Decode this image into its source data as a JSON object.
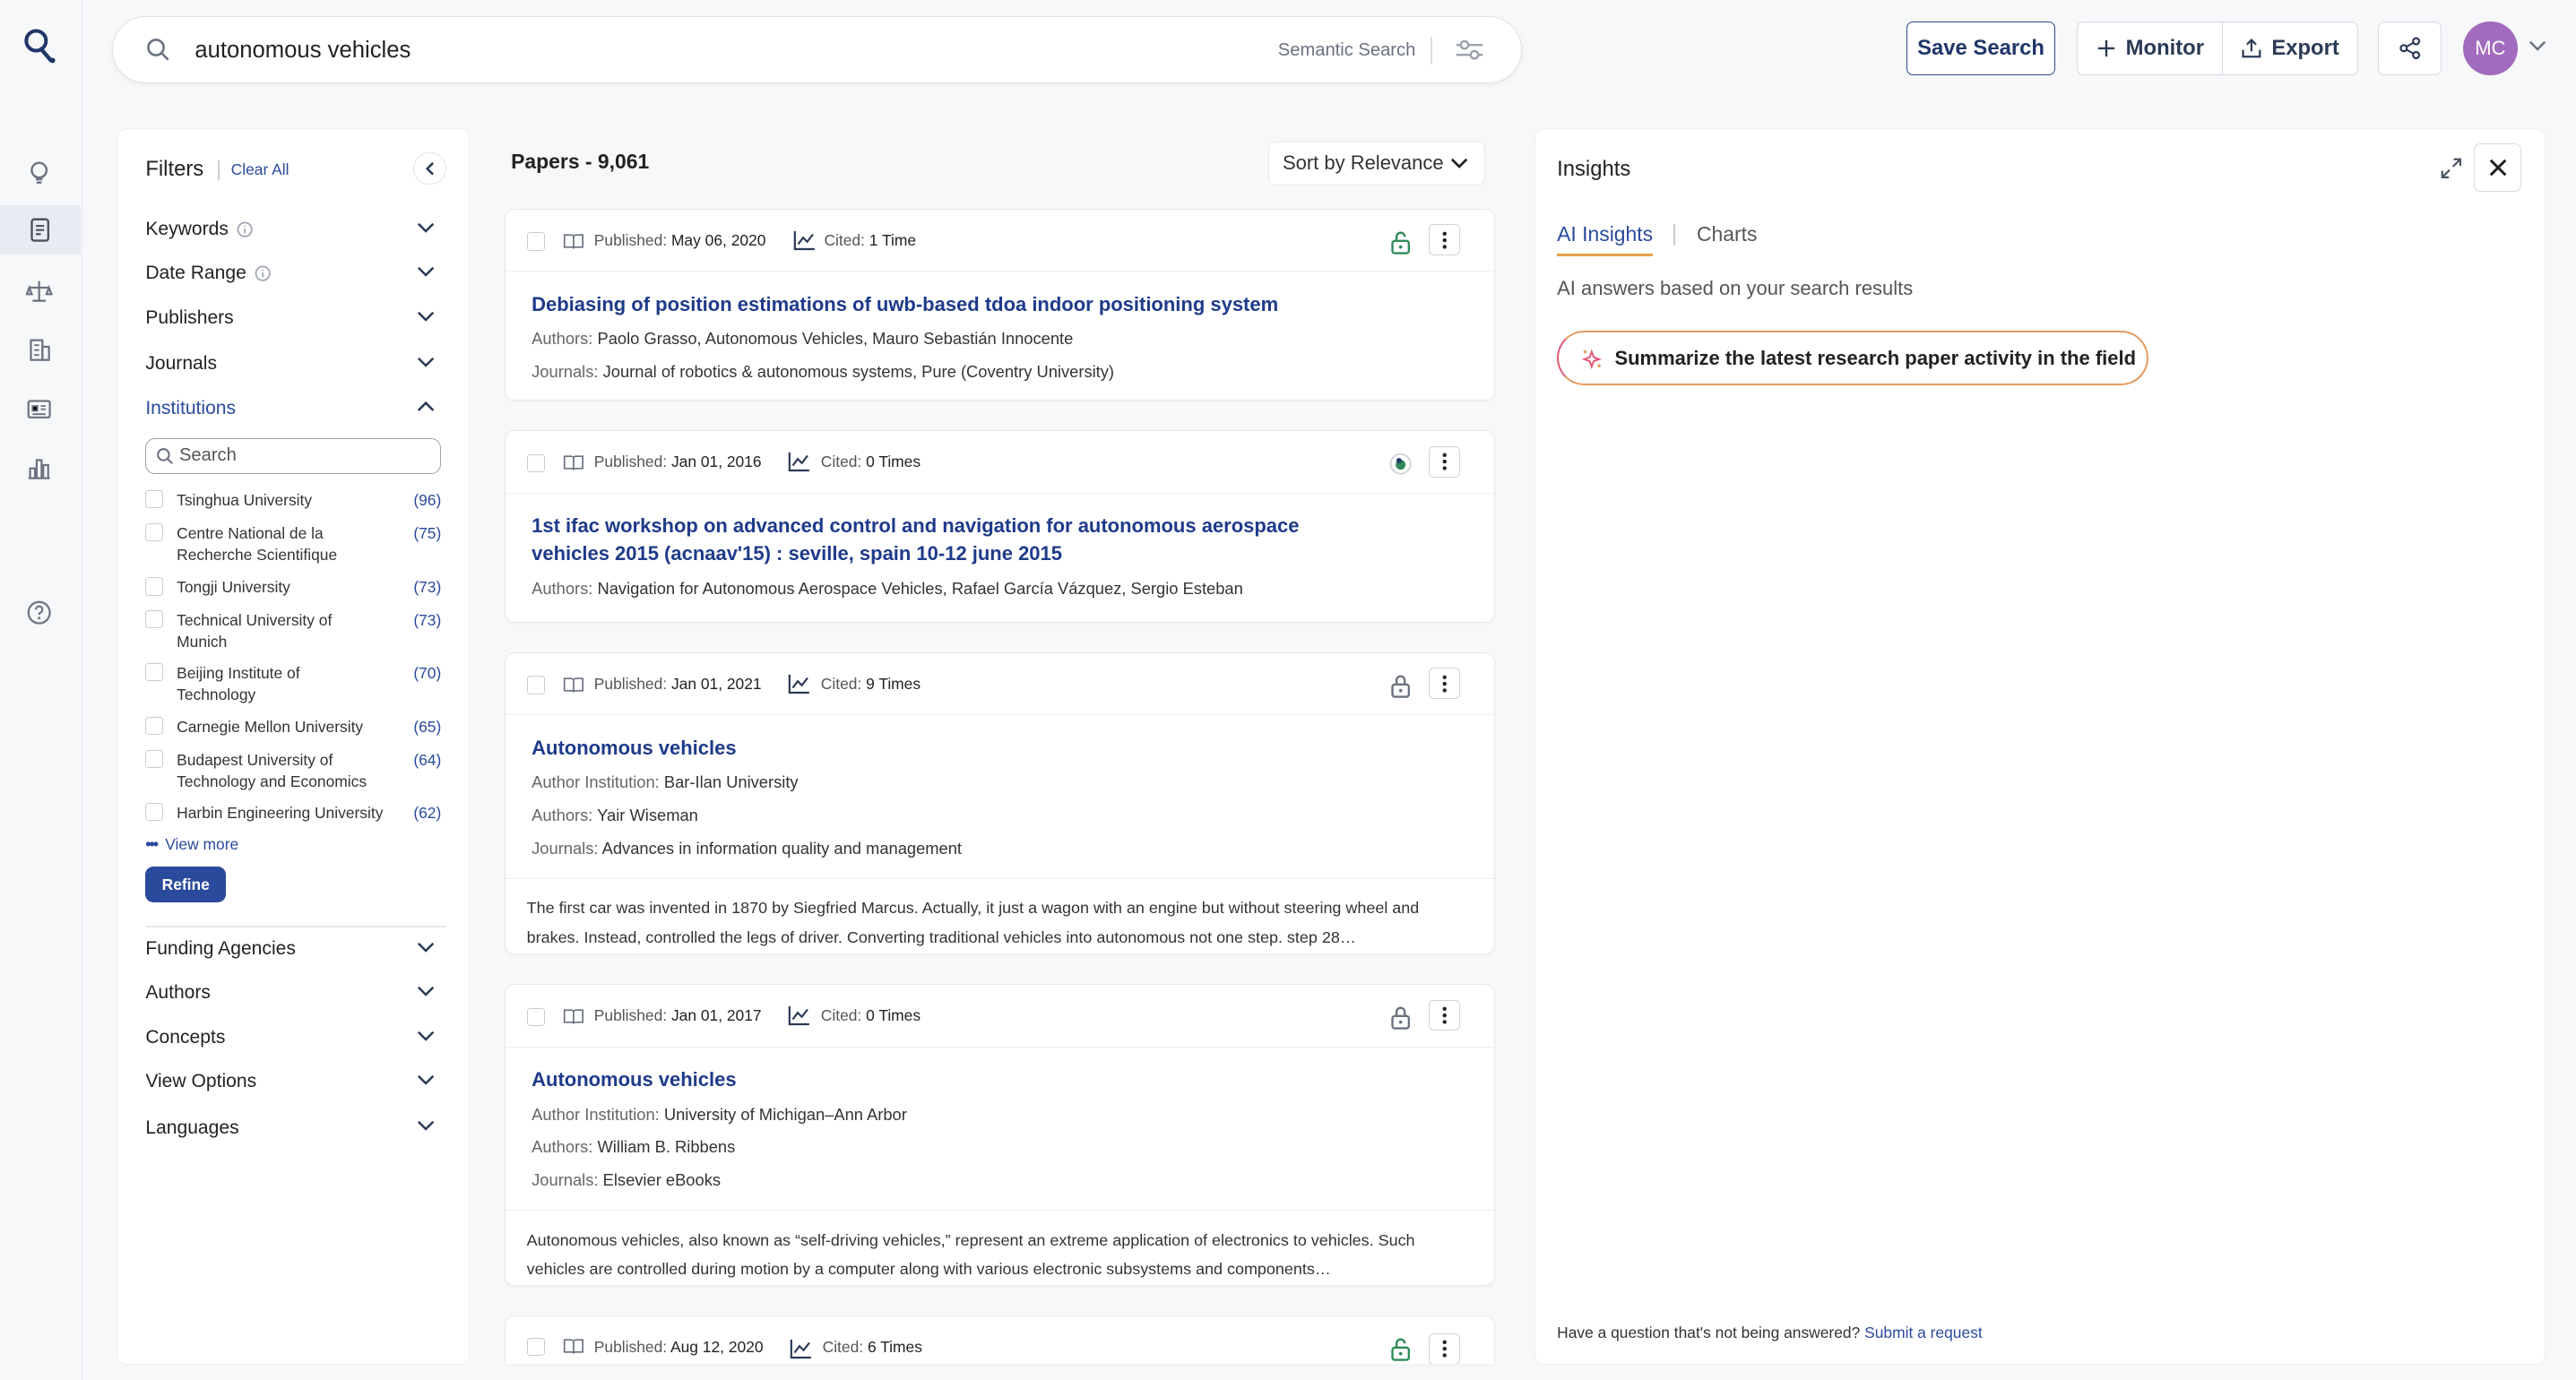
{
  "search": {
    "query": "autonomous vehicles",
    "mode_label": "Semantic Search"
  },
  "header": {
    "save_label": "Save Search",
    "monitor_label": "Monitor",
    "export_label": "Export",
    "avatar_initials": "MC"
  },
  "filters": {
    "title": "Filters",
    "clear_label": "Clear All",
    "sections_top": [
      {
        "label": "Keywords",
        "info": true
      },
      {
        "label": "Date Range",
        "info": true
      },
      {
        "label": "Publishers",
        "info": false
      },
      {
        "label": "Journals",
        "info": false
      },
      {
        "label": "Institutions",
        "info": false,
        "open": true
      }
    ],
    "institution_search_placeholder": "Search",
    "institutions": [
      {
        "name": "Tsinghua University",
        "count": "(96)"
      },
      {
        "name": "Centre National de la Recherche Scientifique",
        "count": "(75)"
      },
      {
        "name": "Tongji University",
        "count": "(73)"
      },
      {
        "name": "Technical University of Munich",
        "count": "(73)"
      },
      {
        "name": "Beijing Institute of Technology",
        "count": "(70)"
      },
      {
        "name": "Carnegie Mellon University",
        "count": "(65)"
      },
      {
        "name": "Budapest University of Technology and Economics",
        "count": "(64)"
      },
      {
        "name": "Harbin Engineering University",
        "count": "(62)"
      }
    ],
    "view_more_label": "View more",
    "refine_label": "Refine",
    "sections_bottom": [
      {
        "label": "Funding Agencies"
      },
      {
        "label": "Authors"
      },
      {
        "label": "Concepts"
      },
      {
        "label": "View Options"
      },
      {
        "label": "Languages"
      }
    ]
  },
  "results": {
    "title": "Papers - 9,061",
    "sort_label": "Sort by Relevance",
    "papers": [
      {
        "published_label": "Published:",
        "published": "May 06, 2020",
        "cited_label": "Cited:",
        "cited": "1 Time",
        "access": "open",
        "title": "Debiasing of position estimations of uwb-based tdoa indoor positioning system",
        "authors_label": "Authors:",
        "authors": "Paolo Grasso, Autonomous Vehicles, Mauro Sebastián Innocente",
        "journals_label": "Journals:",
        "journals": "Journal of robotics & autonomous systems, Pure (Coventry University)"
      },
      {
        "published_label": "Published:",
        "published": "Jan 01, 2016",
        "cited_label": "Cited:",
        "cited": "0 Times",
        "access": "bronze",
        "title": "1st ifac workshop on advanced control and navigation for autonomous aerospace vehicles 2015 (acnaav'15) : seville, spain 10-12 june 2015",
        "authors_label": "Authors:",
        "authors": "Navigation for Autonomous Aerospace Vehicles, Rafael García Vázquez, Sergio Esteban"
      },
      {
        "published_label": "Published:",
        "published": "Jan 01, 2021",
        "cited_label": "Cited:",
        "cited": "9 Times",
        "access": "closed",
        "title": "Autonomous vehicles",
        "institution_label": "Author Institution:",
        "institution": "Bar-Ilan University",
        "authors_label": "Authors:",
        "authors": "Yair Wiseman",
        "journals_label": "Journals:",
        "journals": "Advances in information quality and management",
        "abstract": "The first car was invented in 1870 by Siegfried Marcus. Actually, it just a wagon with an engine but without steering wheel and brakes. Instead, controlled the legs of driver. Converting traditional vehicles into autonomous not one step. step 28…"
      },
      {
        "published_label": "Published:",
        "published": "Jan 01, 2017",
        "cited_label": "Cited:",
        "cited": "0 Times",
        "access": "closed",
        "title": "Autonomous vehicles",
        "institution_label": "Author Institution:",
        "institution": "University of Michigan–Ann Arbor",
        "authors_label": "Authors:",
        "authors": "William B. Ribbens",
        "journals_label": "Journals:",
        "journals": "Elsevier eBooks",
        "abstract": "Autonomous vehicles, also known as “self-driving vehicles,” represent an extreme application of electronics to vehicles. Such vehicles are controlled during motion by a computer along with various electronic subsystems and components…"
      },
      {
        "published_label": "Published:",
        "published": "Aug 12, 2020",
        "cited_label": "Cited:",
        "cited": "6 Times",
        "access": "open"
      }
    ]
  },
  "insights": {
    "title": "Insights",
    "tab_ai": "AI Insights",
    "tab_charts": "Charts",
    "subtitle": "AI answers based on your search results",
    "suggestion": "Summarize the latest research paper activity in the field",
    "footer_text": "Have a question that's not being answered?",
    "footer_link": "Submit a request"
  },
  "colors": {
    "primary": "#2a4a9c",
    "title_blue": "#1e3a8a",
    "avatar": "#a26bbd",
    "open_access": "#2e8b57"
  }
}
